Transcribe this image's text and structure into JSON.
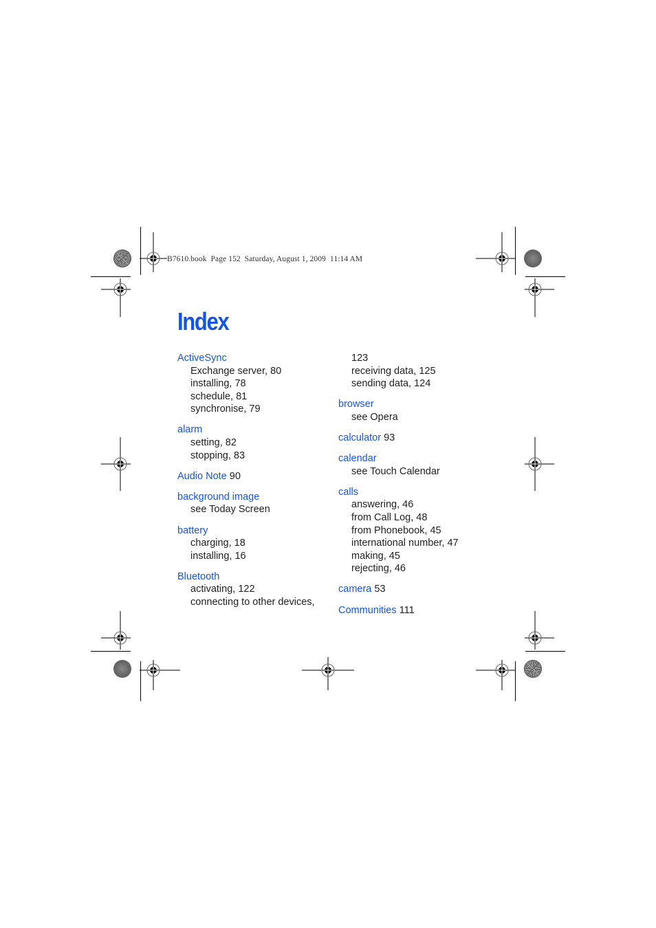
{
  "header": {
    "print_slug": "B7610.book  Page 152  Saturday, August 1, 2009  11:14 AM"
  },
  "page_title": "Index",
  "colors": {
    "accent_blue": "#1455e6",
    "body_text": "#222222"
  },
  "columns": [
    {
      "entries": [
        {
          "term": "ActiveSync",
          "page": "",
          "subs": [
            "Exchange server, 80",
            "installing, 78",
            "schedule, 81",
            "synchronise, 79"
          ]
        },
        {
          "term": "alarm",
          "page": "",
          "subs": [
            "setting, 82",
            "stopping, 83"
          ]
        },
        {
          "term": "Audio Note",
          "page": "90",
          "subs": []
        },
        {
          "term": "background image",
          "page": "",
          "subs": [
            "see Today Screen"
          ]
        },
        {
          "term": "battery",
          "page": "",
          "subs": [
            "charging, 18",
            "installing, 16"
          ]
        },
        {
          "term": "Bluetooth",
          "page": "",
          "subs": [
            "activating, 122",
            "connecting to other devices,"
          ]
        }
      ]
    },
    {
      "continuation": [
        "123",
        "receiving data, 125",
        "sending data, 124"
      ],
      "entries": [
        {
          "term": "browser",
          "page": "",
          "subs": [
            "see Opera"
          ]
        },
        {
          "term": "calculator",
          "page": "93",
          "subs": []
        },
        {
          "term": "calendar",
          "page": "",
          "subs": [
            "see Touch Calendar"
          ]
        },
        {
          "term": "calls",
          "page": "",
          "subs": [
            "answering, 46",
            "from Call Log, 48",
            "from Phonebook, 45",
            "international number, 47",
            "making, 45",
            "rejecting, 46"
          ]
        },
        {
          "term": "camera",
          "page": "53",
          "subs": []
        },
        {
          "term": "Communities",
          "page": "111",
          "subs": []
        }
      ]
    }
  ],
  "icons": {
    "registration_mark": "crosshair-target-icon",
    "color_disk_starburst": "starburst-disk-icon",
    "color_disk_gray": "gray-disk-icon"
  }
}
